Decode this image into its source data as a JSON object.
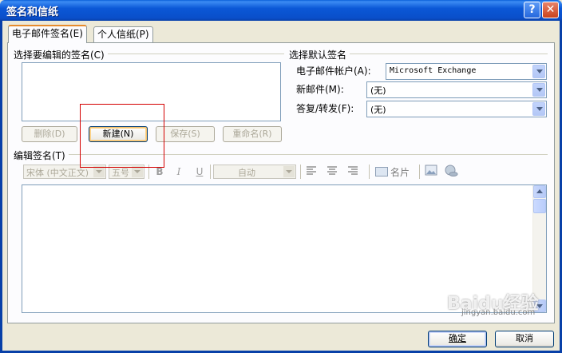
{
  "window": {
    "title": "签名和信纸",
    "help_glyph": "?",
    "close_glyph": "✕"
  },
  "tabs": [
    {
      "label": "电子邮件签名(E)",
      "active": true
    },
    {
      "label": "个人信纸(P)",
      "active": false
    }
  ],
  "edit_select_group": {
    "label": "选择要编辑的签名(C)",
    "signatures": []
  },
  "signature_buttons": {
    "delete": "删除(D)",
    "new": "新建(N)",
    "save": "保存(S)",
    "rename": "重命名(R)"
  },
  "default_signature": {
    "group_label": "选择默认签名",
    "account_label": "电子邮件帐户(A):",
    "account_value": "Microsoft Exchange",
    "new_messages_label": "新邮件(M):",
    "new_messages_value": "(无)",
    "replies_label": "答复/转发(F):",
    "replies_value": "(无)"
  },
  "edit_signature": {
    "label": "编辑签名(T)",
    "font_value": "宋体 (中文正文)",
    "size_value": "五号",
    "bold_glyph": "B",
    "italic_glyph": "I",
    "underline_glyph": "U",
    "color_value": "自动",
    "business_card_label": "名片",
    "content": ""
  },
  "footer": {
    "ok": "确定",
    "cancel": "取消"
  },
  "watermark": {
    "logo_text": "Baidu经验",
    "sub_text": "jingyan.baidu.com"
  },
  "colors": {
    "titlebar": "#0a4ec9",
    "dialog_bg": "#ece9d8",
    "highlight_box": "#d40000",
    "tab_active_accent": "#e68b2c"
  }
}
